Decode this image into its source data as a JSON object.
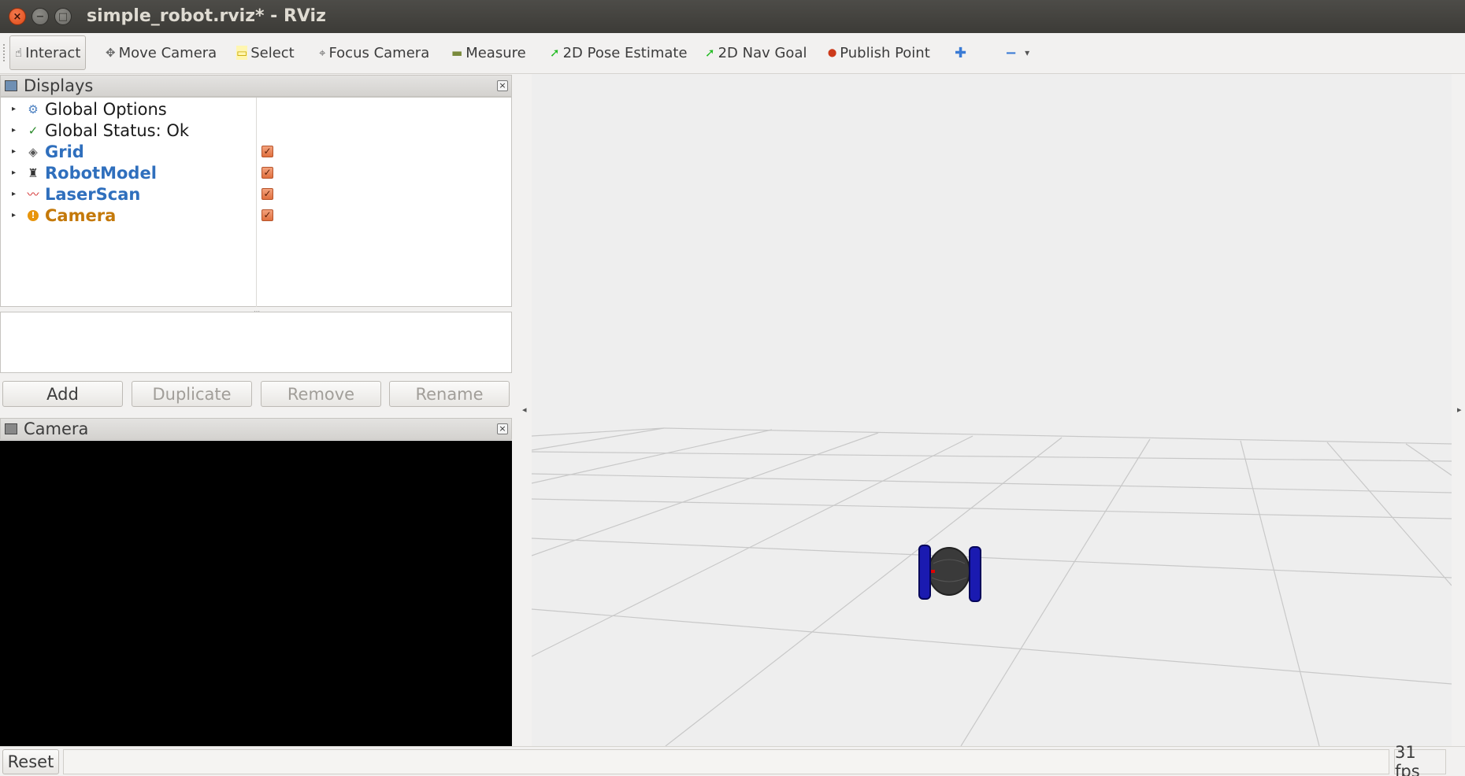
{
  "window": {
    "title": "simple_robot.rviz* - RViz",
    "close_glyph": "×",
    "min_glyph": "−",
    "max_glyph": "□"
  },
  "toolbar": {
    "tools": [
      {
        "label": "Interact",
        "icon": "hand-icon",
        "glyph": "☝",
        "active": true
      },
      {
        "label": "Move Camera",
        "icon": "move-camera-icon",
        "glyph": "✥"
      },
      {
        "label": "Select",
        "icon": "select-icon",
        "glyph": "▭"
      },
      {
        "label": "Focus Camera",
        "icon": "focus-camera-icon",
        "glyph": "⌖"
      },
      {
        "label": "Measure",
        "icon": "measure-icon",
        "glyph": "▬"
      },
      {
        "label": "2D Pose Estimate",
        "icon": "pose-arrow-icon",
        "glyph": "➚"
      },
      {
        "label": "2D Nav Goal",
        "icon": "nav-arrow-icon",
        "glyph": "➚"
      },
      {
        "label": "Publish Point",
        "icon": "map-pin-icon",
        "glyph": "⬤"
      }
    ],
    "add_tool_glyph": "✚",
    "remove_tool_glyph": "−",
    "dropdown_glyph": "▾"
  },
  "displays_panel": {
    "title": "Displays",
    "close_glyph": "×",
    "items": [
      {
        "label": "Global Options",
        "icon": "gear-icon",
        "glyph": "⚙",
        "style": "black",
        "checked": null
      },
      {
        "label": "Global Status: Ok",
        "icon": "check-icon",
        "glyph": "✓",
        "style": "black",
        "checked": null
      },
      {
        "label": "Grid",
        "icon": "grid-icon",
        "glyph": "◈",
        "style": "blue",
        "checked": true
      },
      {
        "label": "RobotModel",
        "icon": "robot-icon",
        "glyph": "♜",
        "style": "blue",
        "checked": true
      },
      {
        "label": "LaserScan",
        "icon": "laser-scan-icon",
        "glyph": "〰",
        "style": "blue",
        "checked": true
      },
      {
        "label": "Camera",
        "icon": "warning-icon",
        "glyph": "!",
        "style": "orange",
        "checked": true
      }
    ],
    "check_glyph": "✓",
    "expand_glyph": "▸",
    "buttons": {
      "add": "Add",
      "duplicate": "Duplicate",
      "remove": "Remove",
      "rename": "Rename"
    }
  },
  "camera_panel": {
    "title": "Camera",
    "close_glyph": "×"
  },
  "view3d": {
    "left_arrow": "◂",
    "right_arrow": "▸"
  },
  "statusbar": {
    "reset": "Reset",
    "fps": "31 fps"
  },
  "colors": {
    "label_blue": "#2f6fbd",
    "label_orange": "#c4790a",
    "checkbox": "#e0703f",
    "wheel": "#1a1ab0",
    "robot_body": "#3a3a3a",
    "grid_line": "#c8c8c8"
  }
}
